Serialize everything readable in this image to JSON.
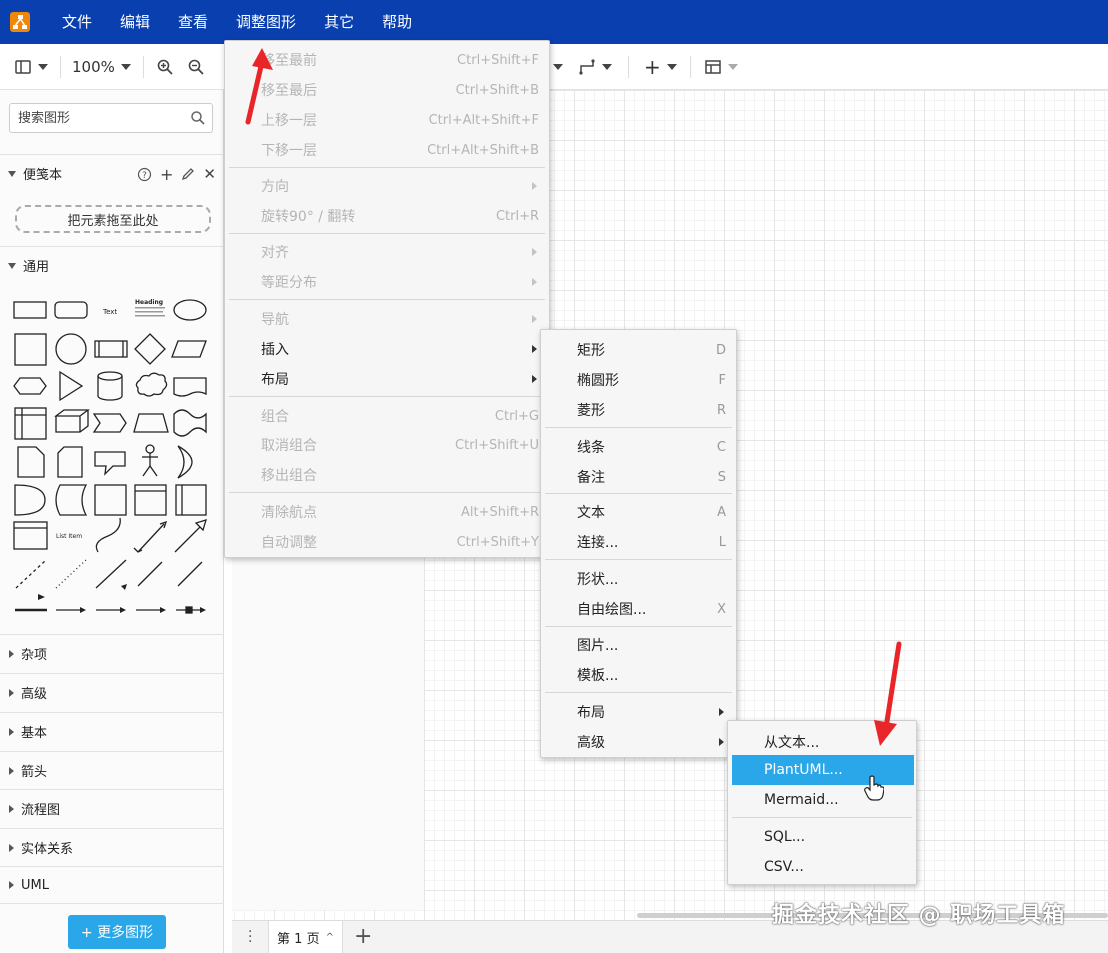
{
  "menubar": {
    "items": [
      "文件",
      "编辑",
      "查看",
      "调整图形",
      "其它",
      "帮助"
    ]
  },
  "toolbar": {
    "zoom": "100%"
  },
  "sidebar": {
    "search_placeholder": "搜索图形",
    "scratchpad_title": "便笺本",
    "drop_zone": "把元素拖至此处",
    "general_title": "通用",
    "shape_text_label": "Text",
    "shape_heading_label": "Heading",
    "shape_list_item_label": "List Item",
    "collapsed_sections": [
      "杂项",
      "高级",
      "基本",
      "箭头",
      "流程图",
      "实体关系",
      "UML"
    ],
    "more_shapes_button": "+ 更多图形"
  },
  "pagebar": {
    "page_tab": "第 1 页"
  },
  "watermark": "掘金技术社区 @ 职场工具箱",
  "arrange_menu": {
    "items": [
      {
        "label": "移至最前",
        "shortcut": "Ctrl+Shift+F",
        "disabled": true
      },
      {
        "label": "移至最后",
        "shortcut": "Ctrl+Shift+B",
        "disabled": true
      },
      {
        "label": "上移一层",
        "shortcut": "Ctrl+Alt+Shift+F",
        "disabled": true
      },
      {
        "label": "下移一层",
        "shortcut": "Ctrl+Alt+Shift+B",
        "disabled": true
      },
      {
        "label": "方向",
        "shortcut": "",
        "disabled": true
      },
      {
        "label": "旋转90° / 翻转",
        "shortcut": "Ctrl+R",
        "disabled": true
      },
      {
        "label": "对齐",
        "shortcut": "",
        "disabled": true
      },
      {
        "label": "等距分布",
        "shortcut": "",
        "disabled": true
      },
      {
        "label": "导航",
        "shortcut": "",
        "disabled": true
      },
      {
        "label": "插入",
        "shortcut": "",
        "disabled": false
      },
      {
        "label": "布局",
        "shortcut": "",
        "disabled": false
      },
      {
        "label": "组合",
        "shortcut": "Ctrl+G",
        "disabled": true
      },
      {
        "label": "取消组合",
        "shortcut": "Ctrl+Shift+U",
        "disabled": true
      },
      {
        "label": "移出组合",
        "shortcut": "",
        "disabled": true
      },
      {
        "label": "清除航点",
        "shortcut": "Alt+Shift+R",
        "disabled": true
      },
      {
        "label": "自动调整",
        "shortcut": "Ctrl+Shift+Y",
        "disabled": true
      }
    ]
  },
  "insert_menu": {
    "items": [
      {
        "label": "矩形",
        "shortcut": "D"
      },
      {
        "label": "椭圆形",
        "shortcut": "F"
      },
      {
        "label": "菱形",
        "shortcut": "R"
      },
      {
        "label": "线条",
        "shortcut": "C"
      },
      {
        "label": "备注",
        "shortcut": "S"
      },
      {
        "label": "文本",
        "shortcut": "A"
      },
      {
        "label": "连接...",
        "shortcut": "L"
      },
      {
        "label": "形状...",
        "shortcut": ""
      },
      {
        "label": "自由绘图...",
        "shortcut": "X"
      },
      {
        "label": "图片...",
        "shortcut": ""
      },
      {
        "label": "模板...",
        "shortcut": ""
      },
      {
        "label": "布局",
        "shortcut": ""
      },
      {
        "label": "高级",
        "shortcut": ""
      }
    ]
  },
  "advanced_menu": {
    "items": [
      "从文本...",
      "PlantUML...",
      "Mermaid...",
      "SQL...",
      "CSV..."
    ],
    "highlighted": "PlantUML..."
  },
  "colors": {
    "menubar": "#0a3fb0",
    "highlight": "#29a7e8",
    "arrow": "#e8262a",
    "logo": "#f08705"
  }
}
